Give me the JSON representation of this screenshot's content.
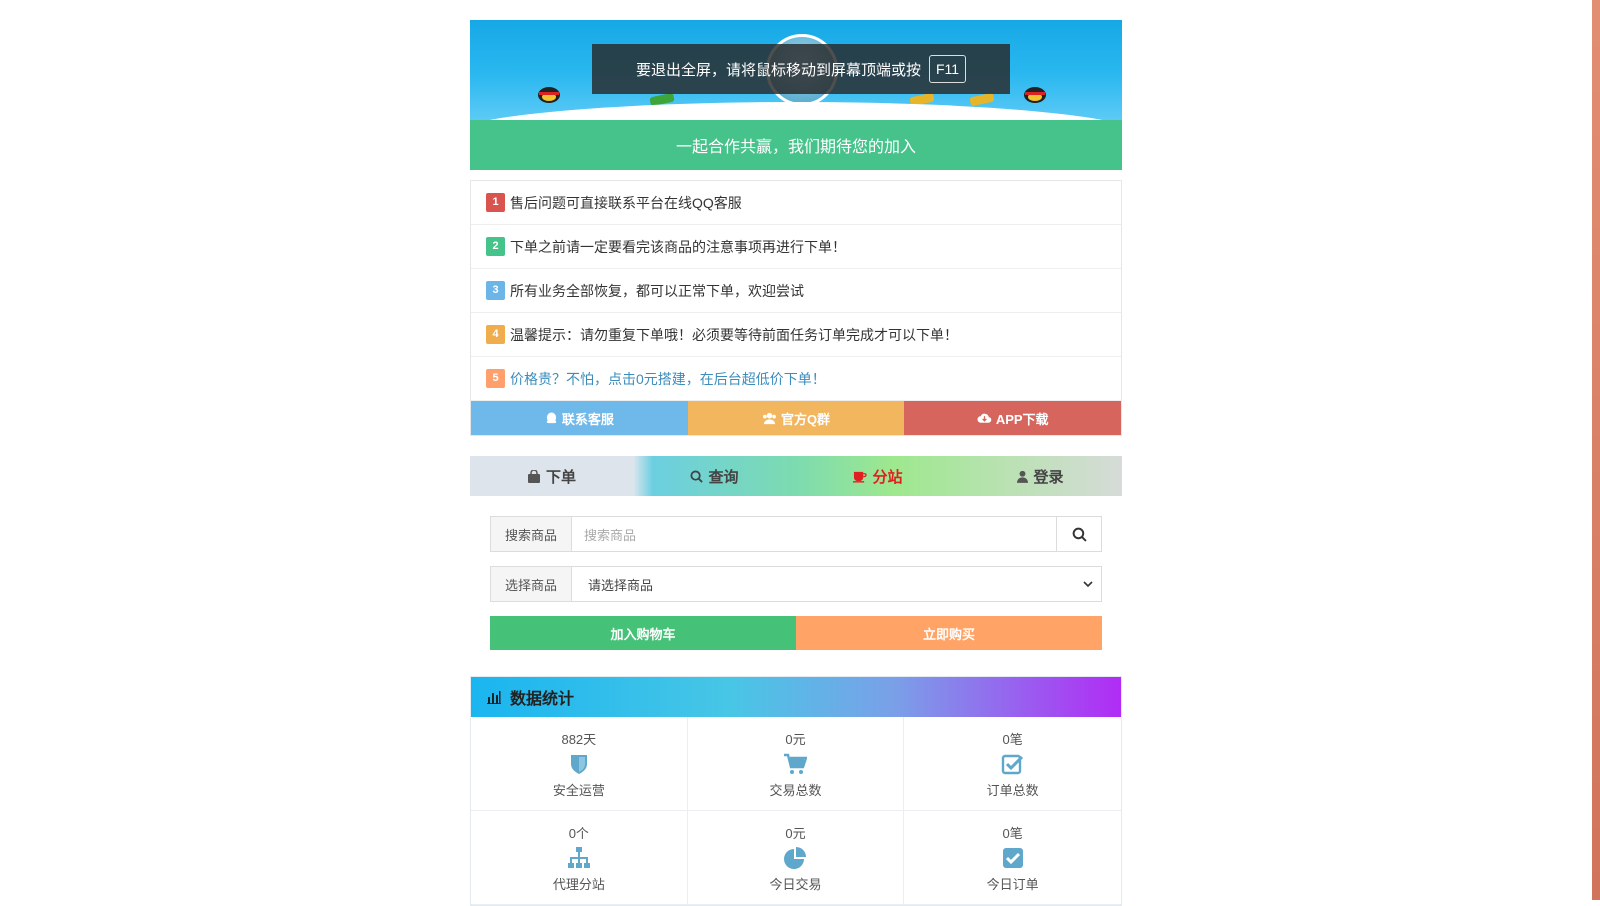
{
  "banner": {
    "fullscreen_tip": "要退出全屏，请将鼠标移动到屏幕顶端或按",
    "fullscreen_key": "F11"
  },
  "slogan": "一起合作共赢，我们期待您的加入",
  "notices": [
    {
      "num": "1",
      "text": "售后问题可直接联系平台在线QQ客服",
      "color": "#d9534f"
    },
    {
      "num": "2",
      "text": "下单之前请一定要看完该商品的注意事项再进行下单！",
      "color": "#45c38b"
    },
    {
      "num": "3",
      "text": "所有业务全部恢复，都可以正常下单，欢迎尝试",
      "color": "#6cb5e8"
    },
    {
      "num": "4",
      "text": "温馨提示：请勿重复下单哦！必须要等待前面任务订单完成才可以下单！",
      "color": "#f0ad4e"
    },
    {
      "num": "5",
      "text": "价格贵？不怕，点击0元搭建，在后台超低价下单！",
      "color": "#ff9f6b"
    }
  ],
  "action_buttons": {
    "contact": "联系客服",
    "group": "官方Q群",
    "app": "APP下载"
  },
  "tabs": {
    "order": "下单",
    "query": "查询",
    "branch": "分站",
    "login": "登录"
  },
  "form": {
    "search_label": "搜索商品",
    "search_placeholder": "搜索商品",
    "select_label": "选择商品",
    "select_value": "请选择商品",
    "add_cart": "加入购物车",
    "buy_now": "立即购买"
  },
  "stats": {
    "title": "数据统计",
    "items": [
      {
        "value": "882天",
        "label": "安全运营",
        "icon": "shield-icon"
      },
      {
        "value": "0元",
        "label": "交易总数",
        "icon": "cart-icon"
      },
      {
        "value": "0笔",
        "label": "订单总数",
        "icon": "checkbox-icon"
      },
      {
        "value": "0个",
        "label": "代理分站",
        "icon": "sitemap-icon"
      },
      {
        "value": "0元",
        "label": "今日交易",
        "icon": "pie-chart-icon"
      },
      {
        "value": "0笔",
        "label": "今日订单",
        "icon": "check-square-icon"
      }
    ]
  },
  "colors": {
    "green": "#45c38b",
    "blue": "#6cb5e8",
    "orange": "#f0b75a",
    "red": "#d9605a",
    "buy": "#ffa366",
    "icon": "#5fa8cc"
  }
}
